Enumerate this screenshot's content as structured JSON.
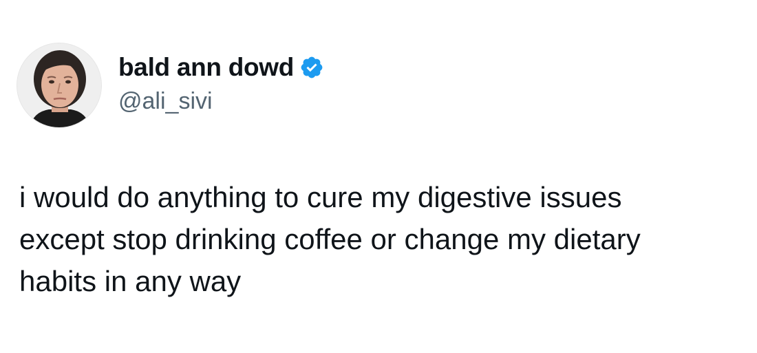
{
  "tweet": {
    "author": {
      "display_name": "bald ann dowd",
      "handle": "@ali_sivi",
      "verified_icon": "verified-badge-icon",
      "avatar": "profile-photo"
    },
    "text_lines": [
      "i would do anything to cure my digestive issues",
      "except stop drinking coffee or change my dietary",
      "habits in any way"
    ]
  },
  "colors": {
    "text": "#0f1419",
    "secondary_text": "#536471",
    "verified_blue": "#1d9bf0",
    "background": "#ffffff"
  }
}
